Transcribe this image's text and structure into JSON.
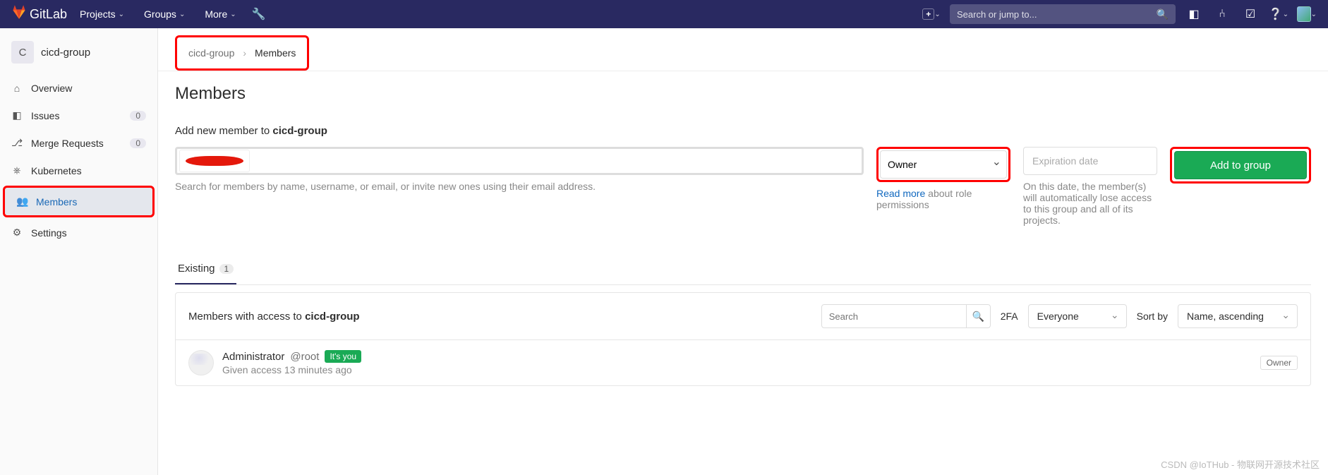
{
  "header": {
    "brand": "GitLab",
    "nav": {
      "projects": "Projects",
      "groups": "Groups",
      "more": "More"
    },
    "search_placeholder": "Search or jump to..."
  },
  "sidebar": {
    "group_initial": "C",
    "group_name": "cicd-group",
    "items": [
      {
        "icon": "⌂",
        "label": "Overview",
        "badge": null
      },
      {
        "icon": "◧",
        "label": "Issues",
        "badge": "0"
      },
      {
        "icon": "⎇",
        "label": "Merge Requests",
        "badge": "0"
      },
      {
        "icon": "⎈",
        "label": "Kubernetes",
        "badge": null
      },
      {
        "icon": "👥",
        "label": "Members",
        "badge": null
      },
      {
        "icon": "⚙",
        "label": "Settings",
        "badge": null
      }
    ]
  },
  "breadcrumb": {
    "parent": "cicd-group",
    "current": "Members"
  },
  "page": {
    "title": "Members"
  },
  "add_member": {
    "label_prefix": "Add new member to ",
    "label_group": "cicd-group",
    "search_help": "Search for members by name, username, or email, or invite new ones using their email address.",
    "role_selected": "Owner",
    "role_help_link": "Read more",
    "role_help_rest": " about role permissions",
    "exp_placeholder": "Expiration date",
    "exp_help": "On this date, the member(s) will automatically lose access to this group and all of its projects.",
    "button": "Add to group"
  },
  "tabs": {
    "existing_label": "Existing",
    "existing_count": "1"
  },
  "panel": {
    "title_prefix": "Members with access to ",
    "title_group": "cicd-group",
    "search_placeholder": "Search",
    "fa_label": "2FA",
    "fa_value": "Everyone",
    "sort_label": "Sort by",
    "sort_value": "Name, ascending"
  },
  "member": {
    "name": "Administrator",
    "username": "@root",
    "you_badge": "It's you",
    "meta": "Given access 13 minutes ago",
    "role": "Owner"
  },
  "watermark": "CSDN @IoTHub - 物联网开源技术社区"
}
